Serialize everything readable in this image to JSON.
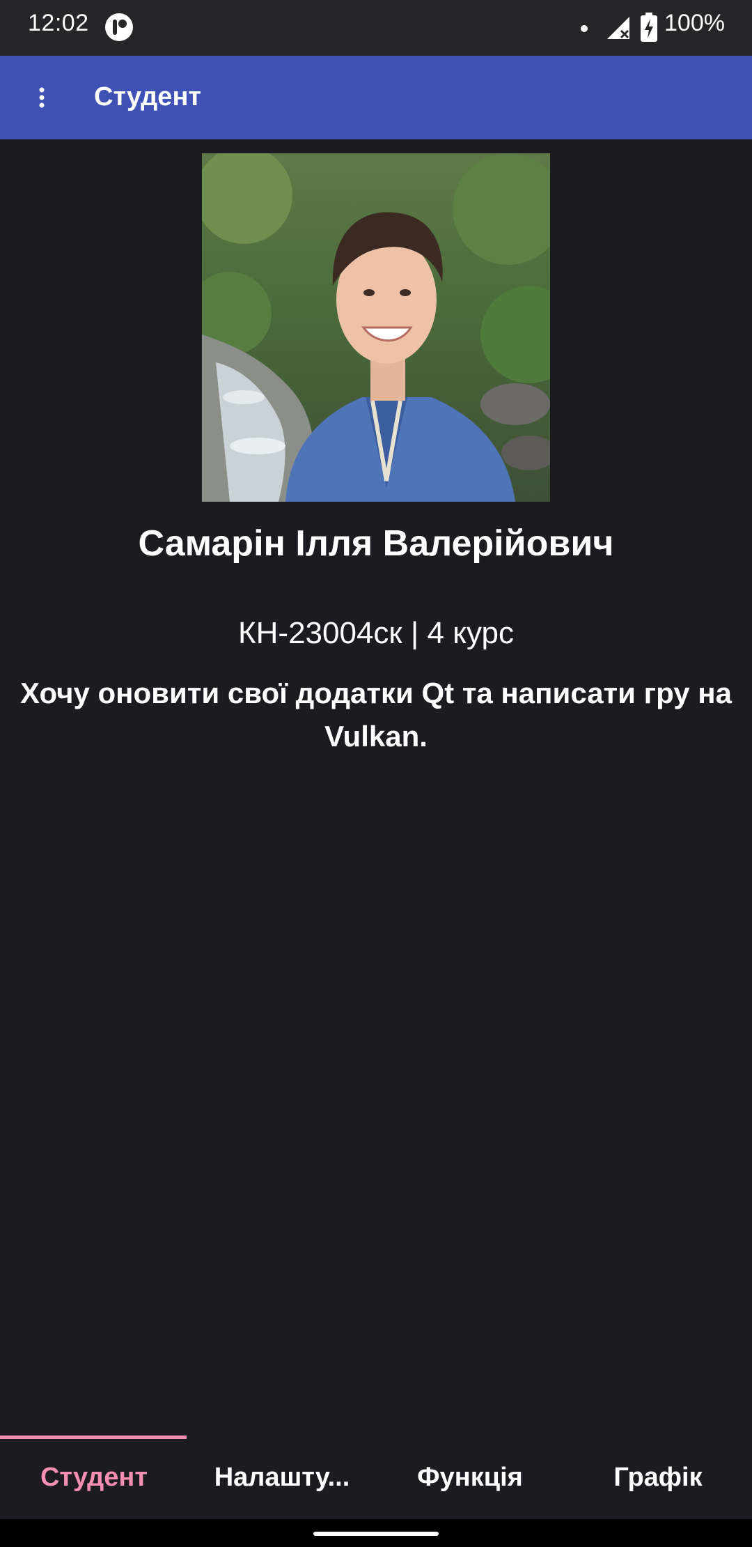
{
  "status_bar": {
    "time": "12:02",
    "battery": "100%",
    "icons": [
      "app-notification-icon",
      "notification-dot-icon",
      "signal-icon",
      "battery-charging-icon"
    ]
  },
  "app_bar": {
    "title": "Студент",
    "menu_icon": "more-vertical-icon"
  },
  "profile": {
    "photo": "student-portrait-photo",
    "name": "Самарін Ілля Валерійович",
    "group": "КН-23004ск | 4 курс",
    "goal": "Хочу оновити свої додатки Qt та написати гру на Vulkan."
  },
  "tabs": [
    {
      "label": "Студент",
      "active": true
    },
    {
      "label": "Налашту...",
      "active": false
    },
    {
      "label": "Функція",
      "active": false
    },
    {
      "label": "Графік",
      "active": false
    }
  ],
  "colors": {
    "app_bar": "#3f51b5",
    "background": "#1c1b1f",
    "active_tab": "#f48fb1"
  }
}
